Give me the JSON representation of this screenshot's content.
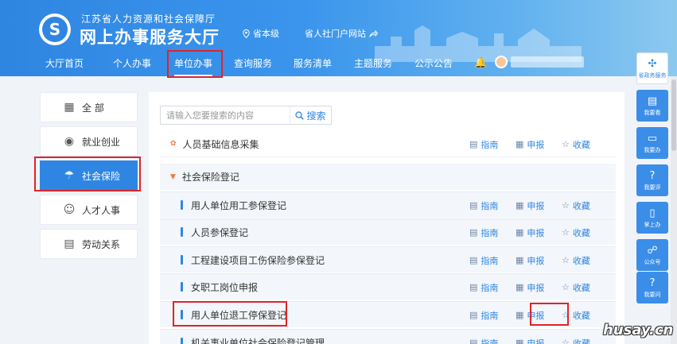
{
  "header": {
    "org_name": "江苏省人力资源和社会保障厅",
    "site_title": "网上办事服务大厅",
    "location": "省本级",
    "portal_link": "省人社门户网站"
  },
  "nav": {
    "items": [
      "大厅首页",
      "个人办事",
      "单位办事",
      "查询服务",
      "服务清单",
      "主题服务",
      "公示公告"
    ],
    "active": "单位办事"
  },
  "sidebar": {
    "items": [
      "全 部",
      "就业创业",
      "社会保险",
      "人才人事",
      "劳动关系"
    ],
    "active": "社会保险"
  },
  "search": {
    "placeholder": "请输入您要搜索的内容",
    "button_label": "搜索"
  },
  "actions": {
    "guide": "指南",
    "apply": "申报",
    "favorite": "收藏"
  },
  "list": {
    "top_item": "人员基础信息采集",
    "group_title": "社会保险登记",
    "sub_items": [
      "用人单位用工参保登记",
      "人员参保登记",
      "工程建设项目工伤保险参保登记",
      "女职工岗位申报",
      "用人单位退工停保登记",
      "机关事业单位社会保险登记管理"
    ]
  },
  "float_toolbar": {
    "items": [
      "省政务服务",
      "我要看",
      "我要办",
      "我要评",
      "掌上办",
      "公众号",
      "我要问"
    ]
  },
  "watermark": "husay.cn",
  "colors": {
    "brand_blue": "#2f86e2",
    "highlight_red": "#e0232a",
    "accent_orange": "#ef7b3b"
  }
}
